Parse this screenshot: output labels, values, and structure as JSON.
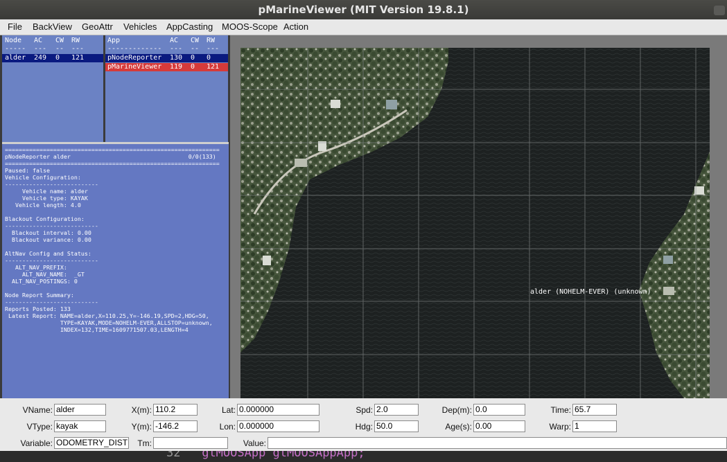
{
  "window": {
    "title": "pMarineViewer (MIT Version 19.8.1)"
  },
  "menu": [
    "File",
    "BackView",
    "GeoAttr",
    "Vehicles",
    "AppCasting",
    "MOOS-Scope",
    "Action"
  ],
  "node_table": {
    "headers": [
      "Node",
      "AC",
      "CW",
      "RW"
    ],
    "divider": [
      "-----",
      "---",
      "--",
      "---"
    ],
    "rows": [
      [
        "alder",
        "249",
        "0",
        "121"
      ]
    ]
  },
  "app_table": {
    "headers": [
      "App",
      "AC",
      "CW",
      "RW"
    ],
    "divider": [
      "-------------",
      "---",
      "--",
      "---"
    ],
    "rows": [
      [
        "pNodeReporter",
        "130",
        "0",
        "0"
      ],
      [
        "pMarineViewer",
        "119",
        "0",
        "121"
      ]
    ]
  },
  "report": {
    "text": "==============================================================\npNodeReporter alder                                  0/0(133)\n==============================================================\nPaused: false\nVehicle Configuration:\n---------------------------\n     Vehicle name: alder\n     Vehicle type: KAYAK\n   Vehicle length: 4.0\n\nBlackout Configuration:\n---------------------------\n  Blackout interval: 0.00\n  Blackout variance: 0.00\n\nAltNav Config and Status:\n---------------------------\n   ALT_NAV_PREFIX:\n     ALT_NAV_NAME:  _GT\n  ALT_NAV_POSTINGS: 0\n\nNode Report Summary:\n---------------------------\nReports Posted: 133\n Latest Report: NAME=alder,X=110.25,Y=-146.19,SPD=2,HDG=50,\n                TYPE=KAYAK,MODE=NOHELM-EVER,ALLSTOP=unknown,\n                INDEX=132,TIME=1609771507.03,LENGTH=4"
  },
  "map": {
    "vessel_label": "alder (NOHELM-EVER) (unknown)"
  },
  "panel": {
    "vname": {
      "label": "VName:",
      "value": "alder"
    },
    "vtype": {
      "label": "VType:",
      "value": "kayak"
    },
    "x": {
      "label": "X(m):",
      "value": "110.2"
    },
    "y": {
      "label": "Y(m):",
      "value": "-146.2"
    },
    "lat": {
      "label": "Lat:",
      "value": "0.000000"
    },
    "lon": {
      "label": "Lon:",
      "value": "0.000000"
    },
    "spd": {
      "label": "Spd:",
      "value": "2.0"
    },
    "hdg": {
      "label": "Hdg:",
      "value": "50.0"
    },
    "dep": {
      "label": "Dep(m):",
      "value": "0.0"
    },
    "age": {
      "label": "Age(s):",
      "value": "0.00"
    },
    "time": {
      "label": "Time:",
      "value": "65.7"
    },
    "warp": {
      "label": "Warp:",
      "value": "1"
    },
    "variable": {
      "label": "Variable:",
      "value": "ODOMETRY_DIST"
    },
    "tm": {
      "label": "Tm:",
      "value": ""
    },
    "valuefld": {
      "label": "Value:",
      "value": ""
    }
  },
  "editor_behind": {
    "number": "32",
    "code": "gtMOOSApp gtMOOSAppApp;"
  }
}
